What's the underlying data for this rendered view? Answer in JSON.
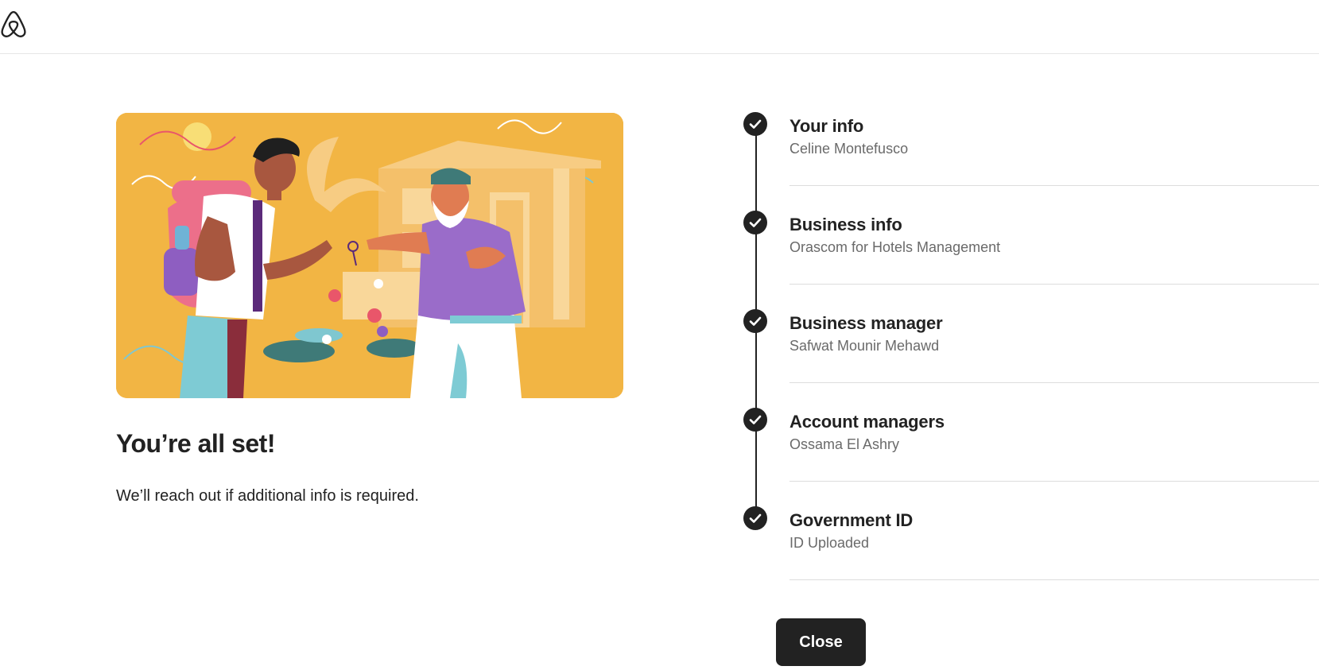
{
  "header": {
    "logo_icon": "airbnb-logo-icon"
  },
  "main": {
    "illustration_icon": "host-welcome-illustration",
    "title": "You’re all set!",
    "subtitle": "We’ll reach out if additional info is required."
  },
  "steps": [
    {
      "label": "Your info",
      "value": "Celine Montefusco",
      "status": "complete"
    },
    {
      "label": "Business info",
      "value": "Orascom for Hotels Management",
      "status": "complete"
    },
    {
      "label": "Business manager",
      "value": "Safwat Mounir Mehawd",
      "status": "complete"
    },
    {
      "label": "Account managers",
      "value": "Ossama El Ashry",
      "status": "complete"
    },
    {
      "label": "Government ID",
      "value": "ID Uploaded",
      "status": "complete"
    }
  ],
  "actions": {
    "close_label": "Close"
  },
  "colors": {
    "primary_dark": "#222222",
    "illustration_bg": "#f2b544",
    "muted_text": "#6a6a6a",
    "divider": "#dddddd"
  }
}
